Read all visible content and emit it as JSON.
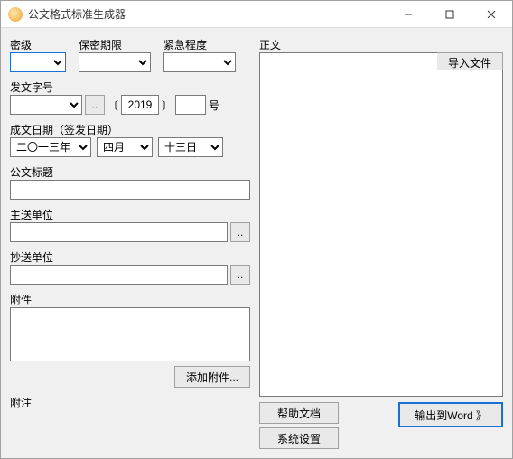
{
  "window": {
    "title": "公文格式标准生成器"
  },
  "left": {
    "secrecy_label": "密级",
    "secrecy_value": "",
    "retention_label": "保密期限",
    "retention_value": "",
    "urgency_label": "紧急程度",
    "urgency_value": "",
    "docnum_label": "发文字号",
    "docnum_prefix": "",
    "docnum_browse": "..",
    "docnum_year_lbracket": "〔",
    "docnum_year": "2019",
    "docnum_year_rbracket": "〕",
    "docnum_serial": "",
    "docnum_suffix": "号",
    "issuedate_label": "成文日期（签发日期）",
    "year": "二〇一三年",
    "month": "四月",
    "day": "十三日",
    "title_label": "公文标题",
    "title_value": "",
    "mainsend_label": "主送单位",
    "mainsend_value": "",
    "mainsend_browse": "..",
    "copysend_label": "抄送单位",
    "copysend_value": "",
    "copysend_browse": "..",
    "attach_label": "附件",
    "attach_value": "",
    "attach_add": "添加附件...",
    "remark_label": "附注"
  },
  "right": {
    "body_label": "正文",
    "body_value": "",
    "import_btn": "导入文件",
    "help_btn": "帮助文档",
    "settings_btn": "系统设置",
    "export_btn": "输出到Word 》"
  }
}
